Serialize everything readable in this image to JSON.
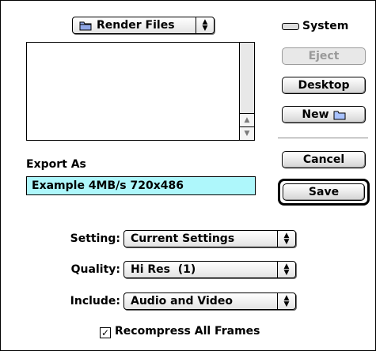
{
  "folder_popup": {
    "label": "Render Files",
    "icon": "folder-icon"
  },
  "volume": {
    "label": "System",
    "icon": "drive-icon"
  },
  "buttons": {
    "eject": "Eject",
    "desktop": "Desktop",
    "new": "New",
    "cancel": "Cancel",
    "save": "Save"
  },
  "export_as": {
    "label": "Export As",
    "value": "Example 4MB/s 720x486"
  },
  "settings": {
    "setting_label": "Setting:",
    "setting_value": "Current Settings",
    "quality_label": "Quality:",
    "quality_value": "Hi Res  (1)",
    "include_label": "Include:",
    "include_value": "Audio and Video"
  },
  "recompress": {
    "label": "Recompress All Frames",
    "checked": true
  },
  "colors": {
    "field_highlight": "#aef7fb",
    "disabled": "#9a9a9a"
  }
}
